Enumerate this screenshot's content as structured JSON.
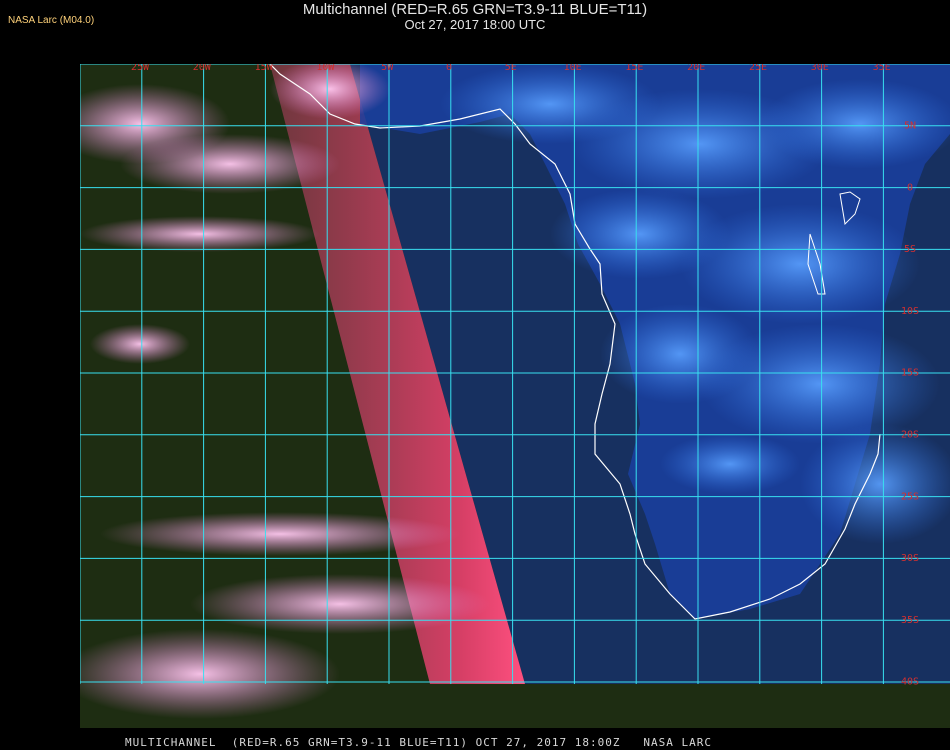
{
  "header": {
    "credit": "NASA Larc (M04.0)",
    "title": "Multichannel (RED=R.65 GRN=T3.9-11 BLUE=T11)",
    "subtitle": "Oct 27, 2017 18:00 UTC"
  },
  "map": {
    "lon_labels": [
      "25W",
      "20W",
      "15W",
      "10W",
      "5W",
      "0",
      "5E",
      "10E",
      "15E",
      "20E",
      "25E",
      "30E",
      "35E"
    ],
    "lat_labels": [
      "5N",
      "0",
      "5S",
      "10S",
      "15S",
      "20S",
      "25S",
      "30S",
      "35S",
      "40S"
    ],
    "colors": {
      "grid": "#38e0f0",
      "label": "#d23030",
      "coast": "#ffffff",
      "land": "#0e2a6a",
      "ocean_east": "#1a3a7a",
      "ocean_west": "#1f3a1a",
      "glint": "#e0406a",
      "cloud_blue": "#4a8cf0",
      "cloud_pink": "#f0a0e0"
    }
  },
  "footer": {
    "text": "MULTICHANNEL  (RED=R.65 GRN=T3.9-11 BLUE=T11) OCT 27, 2017 18:00Z   NASA LARC"
  }
}
